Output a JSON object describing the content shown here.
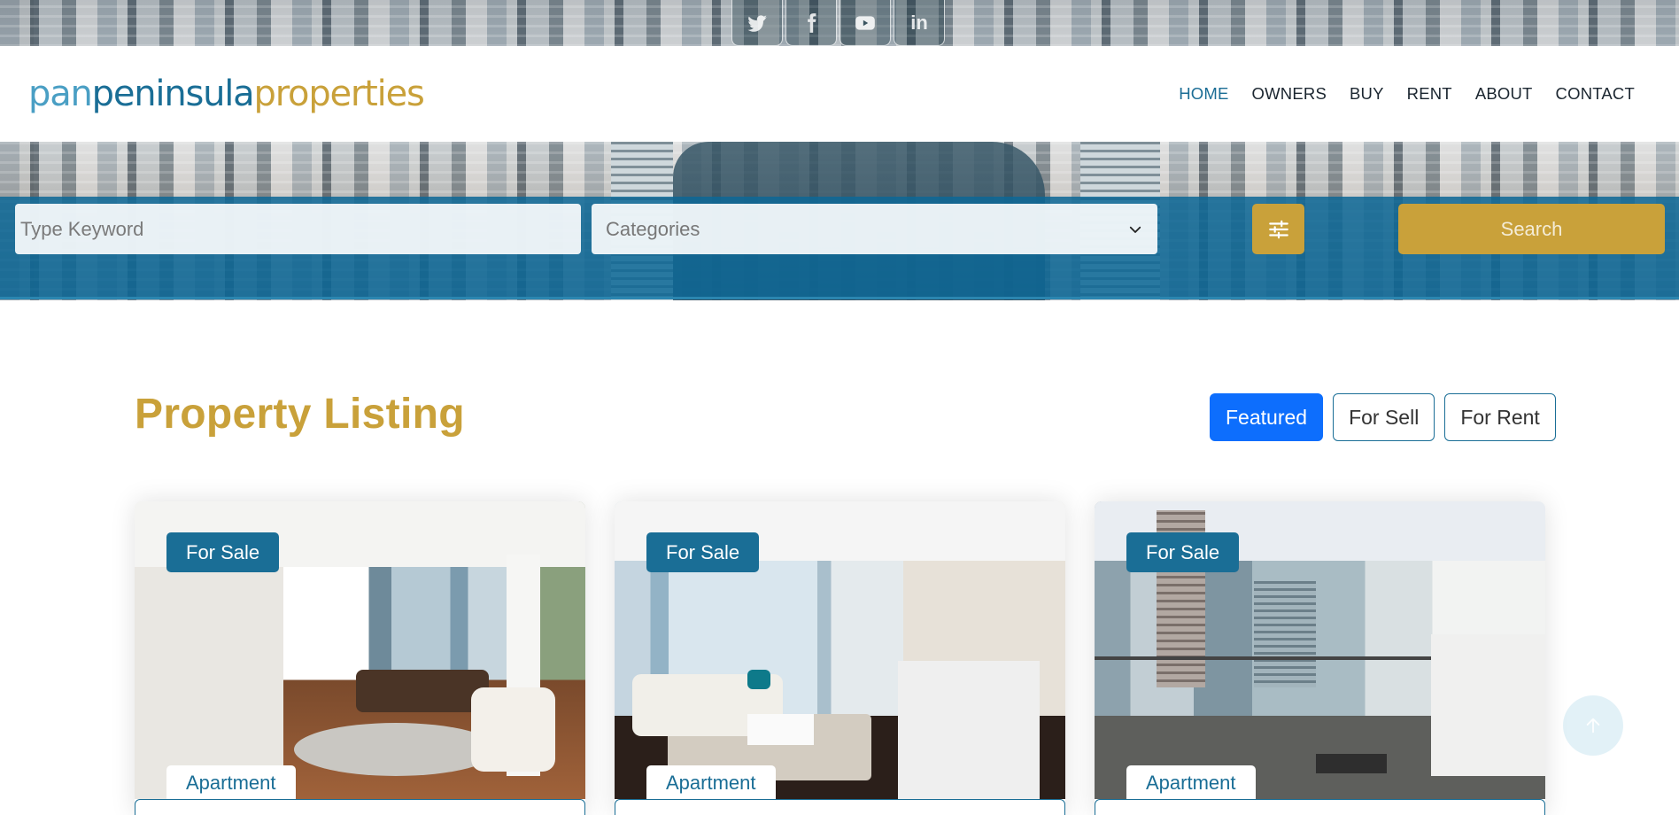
{
  "social": {
    "items": [
      {
        "icon": "twitter-icon"
      },
      {
        "icon": "facebook-icon"
      },
      {
        "icon": "youtube-icon"
      },
      {
        "icon": "linkedin-icon",
        "glyph": "in"
      }
    ]
  },
  "logo": {
    "part1": "pan",
    "part2": "peninsula",
    "part3": "properties"
  },
  "nav": {
    "items": [
      {
        "label": "HOME",
        "active": true
      },
      {
        "label": "OWNERS"
      },
      {
        "label": "BUY"
      },
      {
        "label": "RENT"
      },
      {
        "label": "ABOUT"
      },
      {
        "label": "CONTACT"
      }
    ]
  },
  "search": {
    "keyword_placeholder": "Type Keyword",
    "category_value": "Categories",
    "filter_icon": "sliders-icon",
    "button_label": "Search"
  },
  "listing": {
    "title": "Property Listing",
    "tabs": [
      {
        "label": "Featured",
        "active": true
      },
      {
        "label": "For Sell"
      },
      {
        "label": "For Rent"
      }
    ],
    "cards": [
      {
        "status": "For Sale",
        "type": "Apartment"
      },
      {
        "status": "For Sale",
        "type": "Apartment"
      },
      {
        "status": "For Sale",
        "type": "Apartment"
      }
    ]
  },
  "colors": {
    "brand_blue": "#1a6e96",
    "brand_gold": "#c9a13a",
    "active_tab": "#0d6efd"
  }
}
